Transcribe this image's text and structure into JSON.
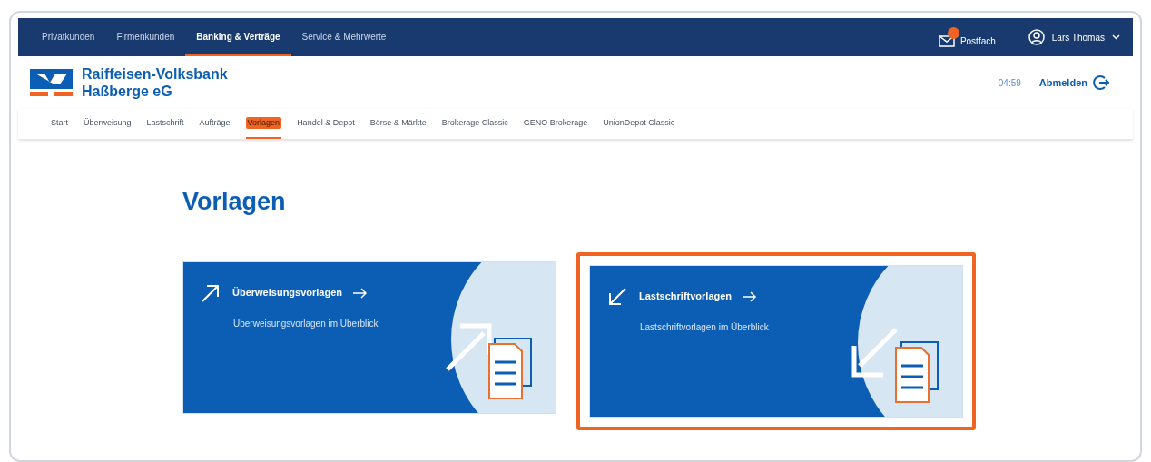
{
  "top_nav": {
    "items": [
      {
        "label": "Privatkunden",
        "selected": false
      },
      {
        "label": "Firmenkunden",
        "selected": false
      },
      {
        "label": "Banking & Verträge",
        "selected": true
      },
      {
        "label": "Service & Mehrwerte",
        "selected": false
      }
    ],
    "mailbox": {
      "label": "Postfach",
      "unread": true
    },
    "user": {
      "name": "Lars Thomas"
    }
  },
  "header": {
    "bank_name": [
      "Raiffeisen-Volksbank",
      "Haßberge eG"
    ],
    "timer": "04:59",
    "logout": "Abmelden"
  },
  "sub_nav": [
    {
      "label": "Start",
      "selected": false
    },
    {
      "label": "Überweisung",
      "selected": false
    },
    {
      "label": "Lastschrift",
      "selected": false
    },
    {
      "label": "Aufträge",
      "selected": false
    },
    {
      "label": "Vorlagen",
      "selected": true
    },
    {
      "label": "Handel & Depot",
      "selected": false
    },
    {
      "label": "Börse & Märkte",
      "selected": false
    },
    {
      "label": "Brokerage Classic",
      "selected": false
    },
    {
      "label": "GENO Brokerage",
      "selected": false
    },
    {
      "label": "UnionDepot Classic",
      "selected": false
    }
  ],
  "page_title": "Vorlagen",
  "cards": [
    {
      "kind": "outgoing",
      "title": "Überweisungsvorlagen",
      "description": "Überweisungsvorlagen im Überblick",
      "highlighted": false
    },
    {
      "kind": "incoming",
      "title": "Lastschriftvorlagen",
      "description": "Lastschriftvorlagen im Überblick",
      "highlighted": true
    }
  ]
}
